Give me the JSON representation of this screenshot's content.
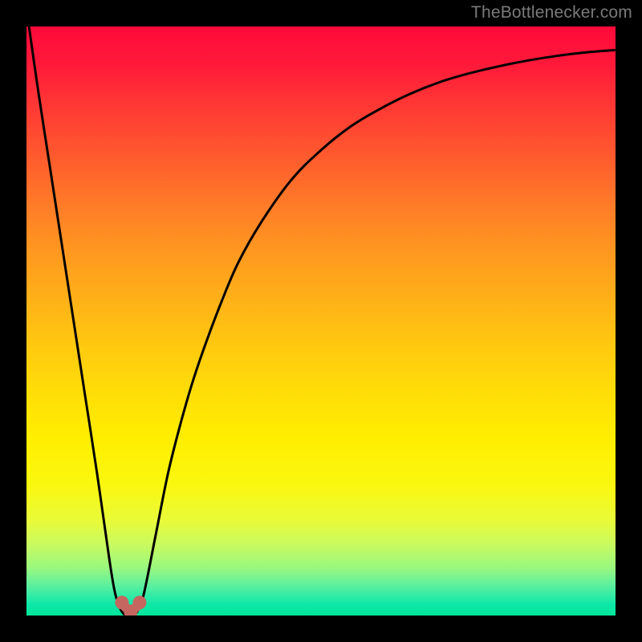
{
  "watermark": {
    "text": "TheBottlenecker.com"
  },
  "chart_data": {
    "type": "line",
    "title": "",
    "xlabel": "",
    "ylabel": "",
    "xlim": [
      0,
      100
    ],
    "ylim": [
      0,
      100
    ],
    "series": [
      {
        "name": "bottleneck-curve",
        "x": [
          0,
          2,
          4,
          6,
          8,
          10,
          12,
          14,
          15,
          16,
          17,
          18,
          19,
          20,
          22,
          24,
          26,
          28,
          30,
          33,
          36,
          40,
          45,
          50,
          55,
          60,
          65,
          70,
          75,
          80,
          85,
          90,
          95,
          100
        ],
        "y": [
          103,
          89,
          76,
          63,
          50,
          37,
          24,
          10,
          4,
          1,
          0,
          0,
          1,
          4,
          14,
          24,
          32,
          39,
          45,
          53,
          60,
          67,
          74,
          79,
          83,
          86,
          88.5,
          90.5,
          92,
          93.2,
          94.2,
          95,
          95.6,
          96
        ]
      }
    ],
    "markers": [
      {
        "name": "marker-left",
        "x": 16.2,
        "y": 2.2
      },
      {
        "name": "marker-right",
        "x": 19.2,
        "y": 2.2
      },
      {
        "name": "marker-bottom",
        "x": 17.7,
        "y": 0.6
      }
    ],
    "marker_color": "#c56660",
    "curve_color": "#000000"
  }
}
